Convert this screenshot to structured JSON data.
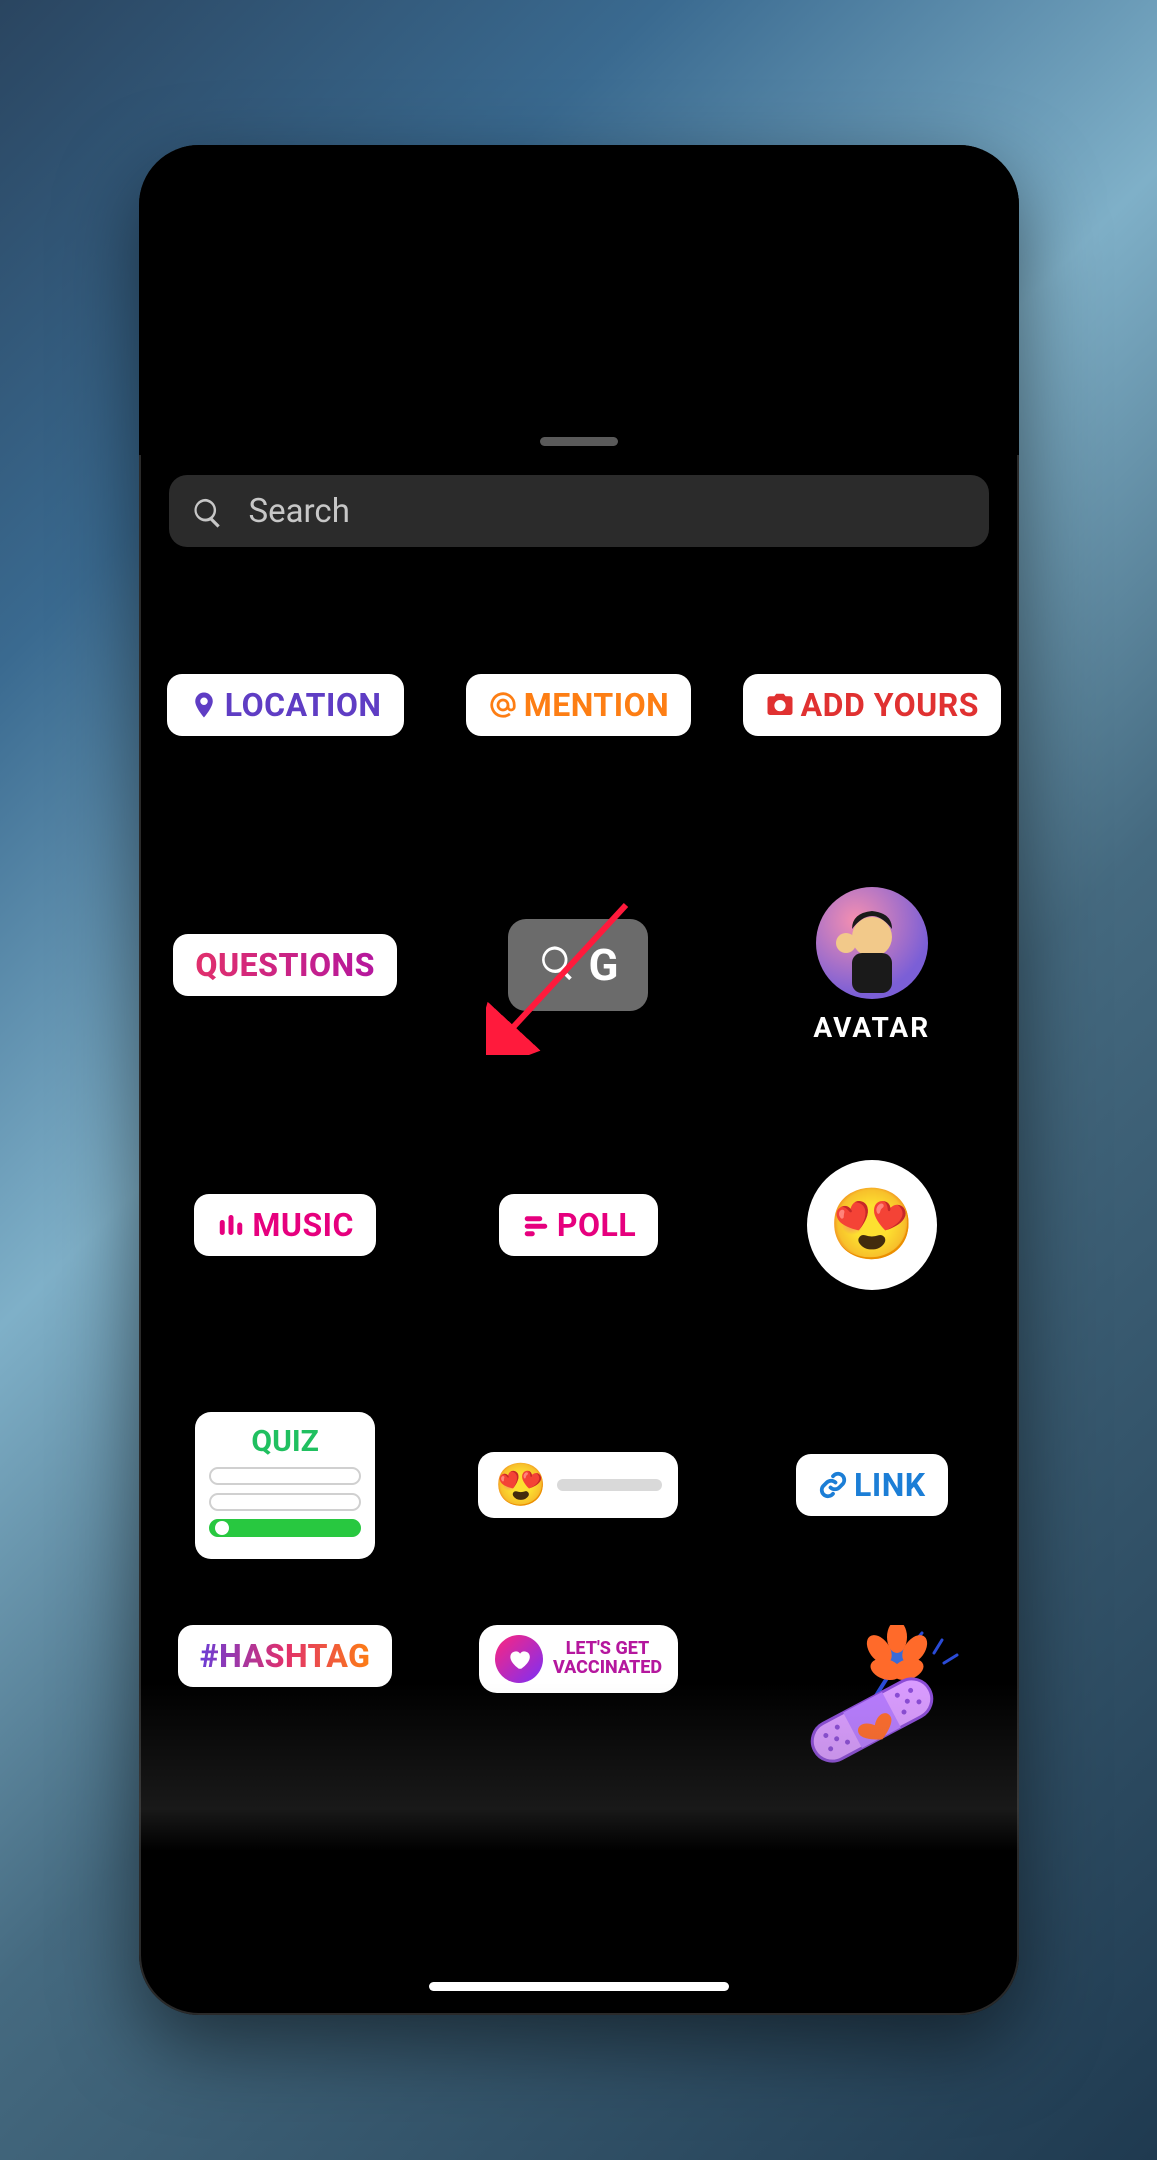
{
  "search": {
    "placeholder": "Search"
  },
  "stickers": {
    "location": {
      "label": "LOCATION"
    },
    "mention": {
      "label": "MENTION"
    },
    "add_yours": {
      "label": "ADD YOURS"
    },
    "questions": {
      "label": "QUESTIONS"
    },
    "gif": {
      "letter": "G"
    },
    "avatar": {
      "label": "AVATAR"
    },
    "music": {
      "label": "MUSIC"
    },
    "poll": {
      "label": "POLL"
    },
    "reaction": {
      "emoji": "😍"
    },
    "quiz": {
      "title": "QUIZ"
    },
    "slider": {
      "emoji": "😍"
    },
    "link": {
      "label": "LINK"
    },
    "hashtag": {
      "label": "#HASHTAG"
    },
    "vaccinated": {
      "line1": "LET'S GET",
      "line2": "VACCINATED"
    }
  },
  "annotation": {
    "arrow_target": "music"
  }
}
